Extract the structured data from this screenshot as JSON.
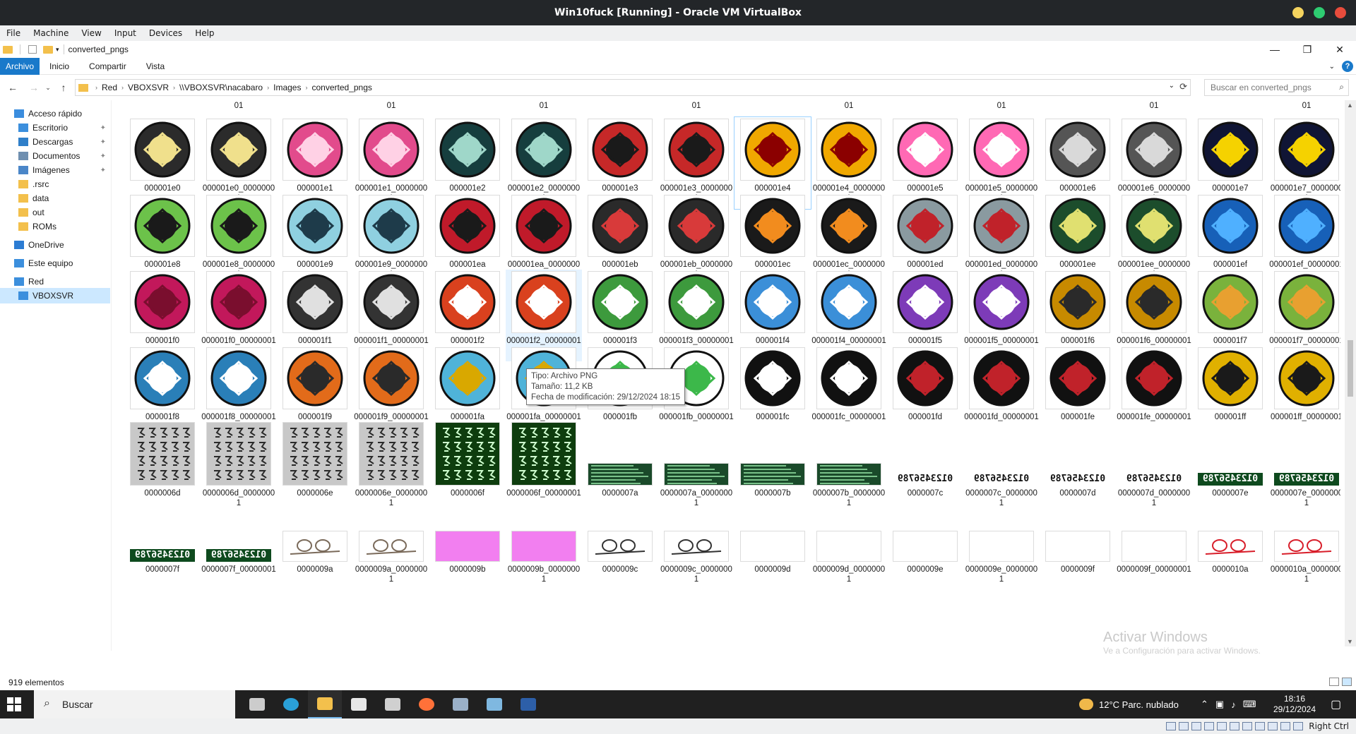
{
  "vm": {
    "title": "Win10fuck [Running] - Oracle VM VirtualBox",
    "menu": [
      "File",
      "Machine",
      "View",
      "Input",
      "Devices",
      "Help"
    ],
    "host_key": "Right Ctrl",
    "window_dot_colors": [
      "#f4d35e",
      "#2ecc71",
      "#e74c3c"
    ]
  },
  "explorer": {
    "window_name": "converted_pngs",
    "ribbon_tabs": [
      "Archivo",
      "Inicio",
      "Compartir",
      "Vista"
    ],
    "breadcrumb": [
      "Red",
      "VBOXSVR",
      "\\\\VBOXSVR\\nacabaro",
      "Images",
      "converted_pngs"
    ],
    "search_placeholder": "Buscar en converted_pngs",
    "status_count": "919 elementos",
    "tooltip": {
      "type": "Tipo: Archivo PNG",
      "size": "Tamaño: 11,2 KB",
      "modified": "Fecha de modificación: 29/12/2024 18:15"
    },
    "nav": [
      {
        "label": "Acceso rápido",
        "icon": "star-icon",
        "color": "#3b8dde",
        "pinned": false,
        "selected": false
      },
      {
        "label": "Escritorio",
        "icon": "desktop-icon",
        "color": "#3c8fdd",
        "pinned": true,
        "selected": false
      },
      {
        "label": "Descargas",
        "icon": "download-icon",
        "color": "#2f7fc9",
        "pinned": true,
        "selected": false
      },
      {
        "label": "Documentos",
        "icon": "document-icon",
        "color": "#6f8fb0",
        "pinned": true,
        "selected": false
      },
      {
        "label": "Imágenes",
        "icon": "pictures-icon",
        "color": "#4a86c8",
        "pinned": true,
        "selected": false
      },
      {
        "label": ".rsrc",
        "icon": "folder-icon",
        "color": "#f3c04c",
        "pinned": false,
        "selected": false
      },
      {
        "label": "data",
        "icon": "folder-icon",
        "color": "#f3c04c",
        "pinned": false,
        "selected": false
      },
      {
        "label": "out",
        "icon": "folder-icon",
        "color": "#f3c04c",
        "pinned": false,
        "selected": false
      },
      {
        "label": "ROMs",
        "icon": "folder-icon",
        "color": "#f3c04c",
        "pinned": false,
        "selected": false
      },
      {
        "label": "OneDrive",
        "icon": "cloud-icon",
        "color": "#2c7cd3",
        "pinned": false,
        "selected": false
      },
      {
        "label": "Este equipo",
        "icon": "computer-icon",
        "color": "#3c8fdd",
        "pinned": false,
        "selected": false
      },
      {
        "label": "Red",
        "icon": "network-icon",
        "color": "#3c8fdd",
        "pinned": false,
        "selected": false
      },
      {
        "label": "VBOXSVR",
        "icon": "network-drive-icon",
        "color": "#3c8fdd",
        "pinned": false,
        "selected": true
      }
    ],
    "grid_rows": [
      {
        "partial_top": true,
        "tiles": [
          {
            "n": "000001e0",
            "c1": "#2b2b2b",
            "c2": "#f0e08c"
          },
          {
            "n": "000001e0_00000001",
            "c1": "#2b2b2b",
            "c2": "#f0e08c"
          },
          {
            "n": "000001e1",
            "c1": "#e24b8c",
            "c2": "#ffd1e5"
          },
          {
            "n": "000001e1_00000001",
            "c1": "#e24b8c",
            "c2": "#ffd1e5"
          },
          {
            "n": "000001e2",
            "c1": "#163e3e",
            "c2": "#9fd7c9"
          },
          {
            "n": "000001e2_00000001",
            "c1": "#163e3e",
            "c2": "#9fd7c9"
          },
          {
            "n": "000001e3",
            "c1": "#c62828",
            "c2": "#1a1a1a"
          },
          {
            "n": "000001e3_00000001",
            "c1": "#c62828",
            "c2": "#1a1a1a"
          },
          {
            "n": "000001e4",
            "c1": "#f0a800",
            "c2": "#8b0000"
          },
          {
            "n": "000001e4_00000001",
            "c1": "#f0a800",
            "c2": "#8b0000"
          },
          {
            "n": "000001e5",
            "c1": "#ff69b4",
            "c2": "#ffffff"
          },
          {
            "n": "000001e5_00000001",
            "c1": "#ff69b4",
            "c2": "#ffffff"
          },
          {
            "n": "000001e6",
            "c1": "#555555",
            "c2": "#d9d9d9"
          },
          {
            "n": "000001e6_00000001",
            "c1": "#555555",
            "c2": "#d9d9d9"
          },
          {
            "n": "000001e7",
            "c1": "#101535",
            "c2": "#f5d200"
          },
          {
            "n": "000001e7_00000001",
            "c1": "#101535",
            "c2": "#f5d200"
          }
        ]
      },
      {
        "partial_top": false,
        "tiles": [
          {
            "n": "000001e8",
            "c1": "#6cc24a",
            "c2": "#1a1a1a"
          },
          {
            "n": "000001e8_00000001",
            "c1": "#6cc24a",
            "c2": "#1a1a1a"
          },
          {
            "n": "000001e9",
            "c1": "#8fd0e0",
            "c2": "#1e3b4a"
          },
          {
            "n": "000001e9_00000001",
            "c1": "#8fd0e0",
            "c2": "#1e3b4a"
          },
          {
            "n": "000001ea",
            "c1": "#c01a2a",
            "c2": "#1a1a1a"
          },
          {
            "n": "000001ea_00000001",
            "c1": "#c01a2a",
            "c2": "#1a1a1a"
          },
          {
            "n": "000001eb",
            "c1": "#2a2a2a",
            "c2": "#d83a3a"
          },
          {
            "n": "000001eb_00000001",
            "c1": "#2a2a2a",
            "c2": "#d83a3a"
          },
          {
            "n": "000001ec",
            "c1": "#1a1a1a",
            "c2": "#f28c1e"
          },
          {
            "n": "000001ec_00000001",
            "c1": "#1a1a1a",
            "c2": "#f28c1e"
          },
          {
            "n": "000001ed",
            "c1": "#8a9aa0",
            "c2": "#c0222a"
          },
          {
            "n": "000001ed_00000001",
            "c1": "#8a9aa0",
            "c2": "#c0222a"
          },
          {
            "n": "000001ee",
            "c1": "#1c4d2c",
            "c2": "#e0e070"
          },
          {
            "n": "000001ee_00000001",
            "c1": "#1c4d2c",
            "c2": "#e0e070"
          },
          {
            "n": "000001ef",
            "c1": "#1760b8",
            "c2": "#4fb0ff"
          },
          {
            "n": "000001ef_00000001",
            "c1": "#1760b8",
            "c2": "#4fb0ff"
          }
        ]
      },
      {
        "partial_top": false,
        "tiles": [
          {
            "n": "000001f0",
            "c1": "#c2185b",
            "c2": "#7a0e2e"
          },
          {
            "n": "000001f0_00000001",
            "c1": "#c2185b",
            "c2": "#7a0e2e"
          },
          {
            "n": "000001f1",
            "c1": "#333333",
            "c2": "#e0e0e0"
          },
          {
            "n": "000001f1_00000001",
            "c1": "#333333",
            "c2": "#e0e0e0"
          },
          {
            "n": "000001f2",
            "c1": "#d9411e",
            "c2": "#ffffff"
          },
          {
            "n": "000001f2_00000001",
            "c1": "#d9411e",
            "c2": "#ffffff"
          },
          {
            "n": "000001f3",
            "c1": "#3d9a3d",
            "c2": "#ffffff"
          },
          {
            "n": "000001f3_00000001",
            "c1": "#3d9a3d",
            "c2": "#ffffff"
          },
          {
            "n": "000001f4",
            "c1": "#3b8fd8",
            "c2": "#ffffff"
          },
          {
            "n": "000001f4_00000001",
            "c1": "#3b8fd8",
            "c2": "#ffffff"
          },
          {
            "n": "000001f5",
            "c1": "#7d3bb8",
            "c2": "#ffffff"
          },
          {
            "n": "000001f5_00000001",
            "c1": "#7d3bb8",
            "c2": "#ffffff"
          },
          {
            "n": "000001f6",
            "c1": "#c78a00",
            "c2": "#2a2a2a"
          },
          {
            "n": "000001f6_00000001",
            "c1": "#c78a00",
            "c2": "#2a2a2a"
          },
          {
            "n": "000001f7",
            "c1": "#7ab23c",
            "c2": "#e8a030"
          },
          {
            "n": "000001f7_00000001",
            "c1": "#7ab23c",
            "c2": "#e8a030"
          }
        ]
      },
      {
        "partial_top": false,
        "tiles": [
          {
            "n": "000001f8",
            "c1": "#2a7fb8",
            "c2": "#ffffff"
          },
          {
            "n": "000001f8_00000001",
            "c1": "#2a7fb8",
            "c2": "#ffffff"
          },
          {
            "n": "000001f9",
            "c1": "#e26b1a",
            "c2": "#2a2a2a"
          },
          {
            "n": "000001f9_00000001",
            "c1": "#e26b1a",
            "c2": "#2a2a2a"
          },
          {
            "n": "000001fa",
            "c1": "#4fb3d9",
            "c2": "#d9a800"
          },
          {
            "n": "000001fa_00000001",
            "c1": "#4fb3d9",
            "c2": "#d9a800"
          },
          {
            "n": "000001fb",
            "c1": "#ffffff",
            "c2": "#3cb84a"
          },
          {
            "n": "000001fb_00000001",
            "c1": "#ffffff",
            "c2": "#3cb84a"
          },
          {
            "n": "000001fc",
            "c1": "#111111",
            "c2": "#ffffff"
          },
          {
            "n": "000001fc_00000001",
            "c1": "#111111",
            "c2": "#ffffff"
          },
          {
            "n": "000001fd",
            "c1": "#111111",
            "c2": "#c0222a"
          },
          {
            "n": "000001fd_00000001",
            "c1": "#111111",
            "c2": "#c0222a"
          },
          {
            "n": "000001fe",
            "c1": "#111111",
            "c2": "#c0222a"
          },
          {
            "n": "000001fe_00000001",
            "c1": "#111111",
            "c2": "#c0222a"
          },
          {
            "n": "000001ff",
            "c1": "#e0b000",
            "c2": "#1a1a1a"
          },
          {
            "n": "000001ff_00000001",
            "c1": "#e0b000",
            "c2": "#1a1a1a"
          }
        ]
      },
      {
        "partial_top": false,
        "tiles": [
          {
            "n": "0000006d",
            "c1": "#c8c8c8",
            "c2": "#2a2a2a",
            "kind": "glyph"
          },
          {
            "n": "0000006d_00000001",
            "c1": "#c8c8c8",
            "c2": "#2a2a2a",
            "kind": "glyph"
          },
          {
            "n": "0000006e",
            "c1": "#c8c8c8",
            "c2": "#2a2a2a",
            "kind": "glyph"
          },
          {
            "n": "0000006e_00000001",
            "c1": "#c8c8c8",
            "c2": "#2a2a2a",
            "kind": "glyph"
          },
          {
            "n": "0000006f",
            "c1": "#0e3d0e",
            "c2": "#d0ffd0",
            "kind": "glyph"
          },
          {
            "n": "0000006f_00000001",
            "c1": "#0e3d0e",
            "c2": "#d0ffd0",
            "kind": "glyph"
          },
          {
            "n": "0000007a",
            "c1": "#1a4a2a",
            "c2": "#7ac28a",
            "kind": "strip"
          },
          {
            "n": "0000007a_00000001",
            "c1": "#1a4a2a",
            "c2": "#7ac28a",
            "kind": "strip"
          },
          {
            "n": "0000007b",
            "c1": "#1a4a2a",
            "c2": "#7ac28a",
            "kind": "strip"
          },
          {
            "n": "0000007b_00000001",
            "c1": "#1a4a2a",
            "c2": "#7ac28a",
            "kind": "strip"
          },
          {
            "n": "0000007c",
            "c1": "#ffffff",
            "c2": "#111111",
            "kind": "digits",
            "digits": "0123456789"
          },
          {
            "n": "0000007c_00000001",
            "c1": "#ffffff",
            "c2": "#111111",
            "kind": "digits",
            "digits": "0123456789"
          },
          {
            "n": "0000007d",
            "c1": "#ffffff",
            "c2": "#111111",
            "kind": "digits",
            "digits": "0123456789"
          },
          {
            "n": "0000007d_00000001",
            "c1": "#ffffff",
            "c2": "#111111",
            "kind": "digits",
            "digits": "0123456789"
          },
          {
            "n": "0000007e",
            "c1": "#0e4a1e",
            "c2": "#ffffff",
            "kind": "digits",
            "digits": "0123456789"
          },
          {
            "n": "0000007e_00000001",
            "c1": "#0e4a1e",
            "c2": "#ffffff",
            "kind": "digits",
            "digits": "0123456789"
          }
        ]
      },
      {
        "partial_top": false,
        "tiles": [
          {
            "n": "0000007f",
            "c1": "#0e4a1e",
            "c2": "#ffffff",
            "kind": "digits",
            "digits": "0123456789"
          },
          {
            "n": "0000007f_00000001",
            "c1": "#0e4a1e",
            "c2": "#ffffff",
            "kind": "digits",
            "digits": "0123456789"
          },
          {
            "n": "0000009a",
            "c1": "#ffffff",
            "c2": "#7a6a5a",
            "kind": "thin"
          },
          {
            "n": "0000009a_00000001",
            "c1": "#ffffff",
            "c2": "#7a6a5a",
            "kind": "thin"
          },
          {
            "n": "0000009b",
            "c1": "#f27ff0",
            "c2": "#f27ff0",
            "kind": "solid"
          },
          {
            "n": "0000009b_00000001",
            "c1": "#f27ff0",
            "c2": "#f27ff0",
            "kind": "solid"
          },
          {
            "n": "0000009c",
            "c1": "#ffffff",
            "c2": "#333333",
            "kind": "thin"
          },
          {
            "n": "0000009c_00000001",
            "c1": "#ffffff",
            "c2": "#333333",
            "kind": "thin"
          },
          {
            "n": "0000009d",
            "c1": "#ffffff",
            "c2": "#ffffff",
            "kind": "solid"
          },
          {
            "n": "0000009d_00000001",
            "c1": "#ffffff",
            "c2": "#ffffff",
            "kind": "solid"
          },
          {
            "n": "0000009e",
            "c1": "#ffffff",
            "c2": "#ffffff",
            "kind": "solid"
          },
          {
            "n": "0000009e_00000001",
            "c1": "#ffffff",
            "c2": "#ffffff",
            "kind": "solid"
          },
          {
            "n": "0000009f",
            "c1": "#ffffff",
            "c2": "#ffffff",
            "kind": "solid"
          },
          {
            "n": "0000009f_00000001",
            "c1": "#ffffff",
            "c2": "#ffffff",
            "kind": "solid"
          },
          {
            "n": "0000010a",
            "c1": "#ffffff",
            "c2": "#d81e2a",
            "kind": "thin"
          },
          {
            "n": "0000010a_00000001",
            "c1": "#ffffff",
            "c2": "#d81e2a",
            "kind": "thin"
          }
        ]
      }
    ],
    "top_cut_labels": [
      "01",
      "01",
      "01",
      "01",
      "01",
      "01",
      "01",
      "01"
    ]
  },
  "watermark": {
    "title": "Activar Windows",
    "sub": "Ve a Configuración para activar Windows."
  },
  "taskbar": {
    "search_label": "Buscar",
    "weather": "12°C  Parc. nublado",
    "time": "18:16",
    "date": "29/12/2024",
    "apps": [
      {
        "name": "task-view-icon",
        "color": "#cccccc"
      },
      {
        "name": "edge-icon",
        "color": "#2aa0d8"
      },
      {
        "name": "file-explorer-icon",
        "color": "#f3c04c"
      },
      {
        "name": "store-icon",
        "color": "#e8e8e8"
      },
      {
        "name": "mail-icon",
        "color": "#d0d0d0"
      },
      {
        "name": "firefox-icon",
        "color": "#ff7139"
      },
      {
        "name": "app-icon",
        "color": "#9ab0c8"
      },
      {
        "name": "app-icon-2",
        "color": "#7fb8e0"
      },
      {
        "name": "powershell-icon",
        "color": "#2d5fa8"
      }
    ]
  }
}
